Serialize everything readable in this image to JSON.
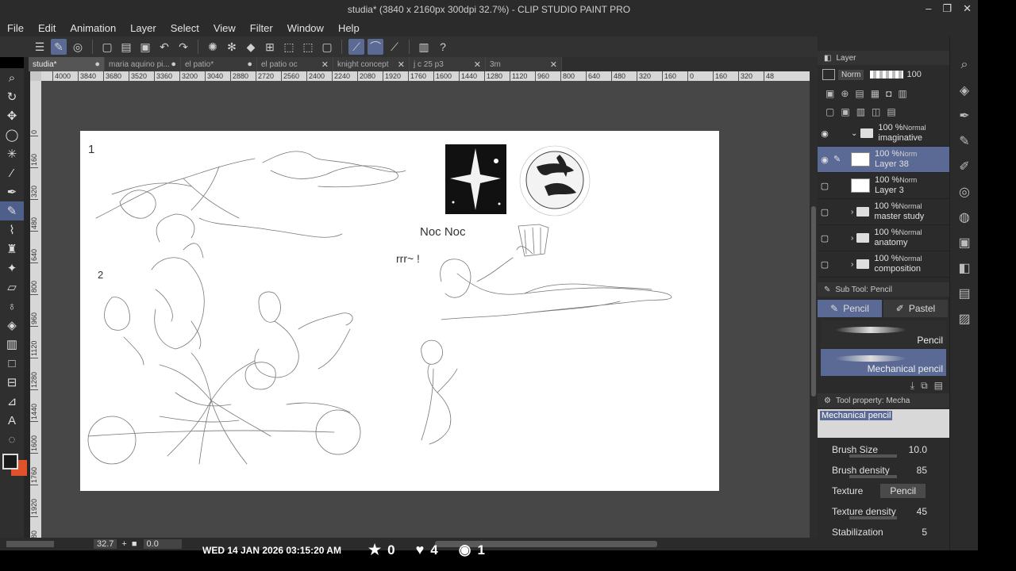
{
  "window": {
    "title": "studia* (3840 x 2160px 300dpi 32.7%)  - CLIP STUDIO PAINT PRO",
    "controls": [
      "–",
      "❐",
      "✕"
    ]
  },
  "menu": [
    "File",
    "Edit",
    "Animation",
    "Layer",
    "Select",
    "View",
    "Filter",
    "Window",
    "Help"
  ],
  "tabs": [
    {
      "label": "studia*",
      "close": "●",
      "active": true
    },
    {
      "label": "maria aquino pi...",
      "close": "●",
      "active": false
    },
    {
      "label": "el patio*",
      "close": "●",
      "active": false
    },
    {
      "label": "el patio oc",
      "close": "✕",
      "active": false
    },
    {
      "label": "knight concept",
      "close": "✕",
      "active": false
    },
    {
      "label": "j c 25 p3",
      "close": "✕",
      "active": false
    },
    {
      "label": "3m",
      "close": "✕",
      "active": false
    }
  ],
  "ruler_top": [
    "4000",
    "3840",
    "3680",
    "3520",
    "3360",
    "3200",
    "3040",
    "2880",
    "2720",
    "2560",
    "2400",
    "2240",
    "2080",
    "1920",
    "1760",
    "1600",
    "1440",
    "1280",
    "1120",
    "960",
    "800",
    "640",
    "480",
    "320",
    "160",
    "0",
    "160",
    "320",
    "48"
  ],
  "ruler_left": [
    "0",
    "160",
    "320",
    "480",
    "640",
    "800",
    "960",
    "1120",
    "1280",
    "1440",
    "1600",
    "1760",
    "1920",
    "2080",
    "2240"
  ],
  "status": {
    "zoom": "32.7",
    "rotation": "0.0"
  },
  "overlay": {
    "datetime": "WED 14 JAN 2026 03:15:20 AM",
    "stars": "0",
    "hearts": "4",
    "views": "1"
  },
  "layer_panel": {
    "title": "Layer",
    "blend_mode": "Norm",
    "opacity": "100",
    "layers": [
      {
        "pct": "100 %",
        "mode": "Normal",
        "name": "imaginative",
        "type": "folder",
        "open": true,
        "visible": true,
        "selected": false
      },
      {
        "pct": "100 %",
        "mode": "Norm",
        "name": "Layer 38",
        "type": "raster",
        "visible": true,
        "selected": true
      },
      {
        "pct": "100 %",
        "mode": "Norm",
        "name": "Layer 3",
        "type": "raster",
        "visible": false,
        "selected": false
      },
      {
        "pct": "100 %",
        "mode": "Normal",
        "name": "master study",
        "type": "folder",
        "open": false,
        "visible": false,
        "selected": false
      },
      {
        "pct": "100 %",
        "mode": "Normal",
        "name": "anatomy",
        "type": "folder",
        "open": false,
        "visible": false,
        "selected": false
      },
      {
        "pct": "100 %",
        "mode": "Normal",
        "name": "composition",
        "type": "folder",
        "open": false,
        "visible": false,
        "selected": false
      }
    ]
  },
  "subtool_panel": {
    "title": "Sub Tool: Pencil",
    "tabs": [
      {
        "label": "Pencil",
        "active": true
      },
      {
        "label": "Pastel",
        "active": false
      }
    ],
    "brushes": [
      {
        "name": "Pencil",
        "selected": false
      },
      {
        "name": "Mechanical pencil",
        "selected": true
      }
    ]
  },
  "tool_property": {
    "title": "Tool property: Mecha",
    "brush_name": "Mechanical pencil",
    "rows": [
      {
        "label": "Brush Size",
        "value": "10.0"
      },
      {
        "label": "Brush density",
        "value": "85"
      },
      {
        "label": "Texture",
        "value": "Pencil"
      },
      {
        "label": "Texture density",
        "value": "45"
      },
      {
        "label": "Stabilization",
        "value": "5"
      }
    ]
  },
  "canvas_text": {
    "noc": "Noc  Noc",
    "prr": "rrr~ !",
    "n1": "1",
    "n2": "2"
  },
  "colors": {
    "accent": "#5a6a95",
    "main_color": "#1a1a1a",
    "sub_color": "#e0522b"
  }
}
